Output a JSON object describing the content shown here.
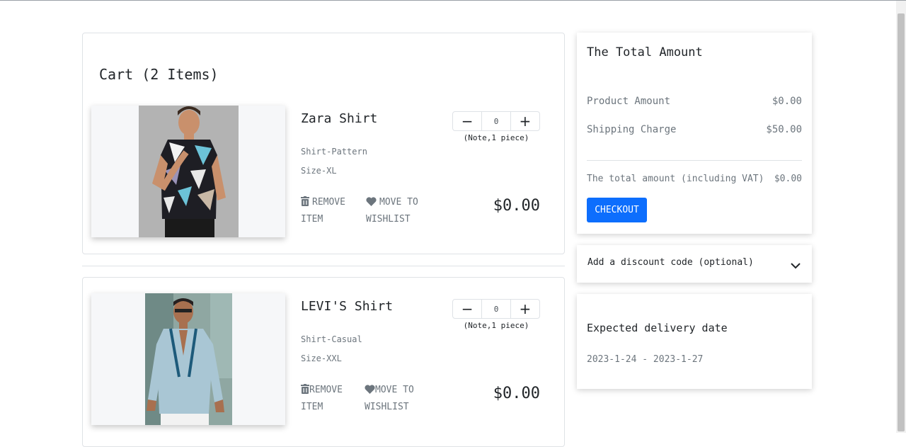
{
  "cart": {
    "title": "Cart (2 Items)",
    "items": [
      {
        "name": "Zara Shirt",
        "pattern": "Shirt-Pattern",
        "size": "Size-XL",
        "quantity": "0",
        "minus": "−",
        "plus": "+",
        "note": "(Note,1 piece)",
        "remove_label": "REMOVE ITEM",
        "wishlist_label": "MOVE TO WISHLIST",
        "price": "$0.00"
      },
      {
        "name": "LEVI'S Shirt",
        "pattern": "Shirt-Casual",
        "size": "Size-XXL",
        "quantity": "0",
        "minus": "−",
        "plus": "+",
        "note": "(Note,1 piece)",
        "remove_label": "REMOVE ITEM",
        "wishlist_label": "MOVE TO WISHLIST",
        "price": "$0.00"
      }
    ]
  },
  "summary": {
    "title": "The Total Amount",
    "product_amount_label": "Product Amount",
    "product_amount_value": "$0.00",
    "shipping_label": "Shipping Charge",
    "shipping_value": "$50.00",
    "total_label": "The total amount (including VAT)",
    "total_value": "$0.00",
    "checkout_label": "CHECKOUT"
  },
  "discount": {
    "label": "Add a discount code (optional)"
  },
  "delivery": {
    "title": "Expected delivery date",
    "dates": "2023-1-24 - 2023-1-27"
  },
  "colors": {
    "accent": "#0d6efd",
    "muted_text": "#6c757d",
    "border": "#dee2e6"
  },
  "icons": {
    "remove": "trash-icon",
    "wishlist": "heart-icon",
    "discount_toggle": "chevron-down-icon"
  }
}
